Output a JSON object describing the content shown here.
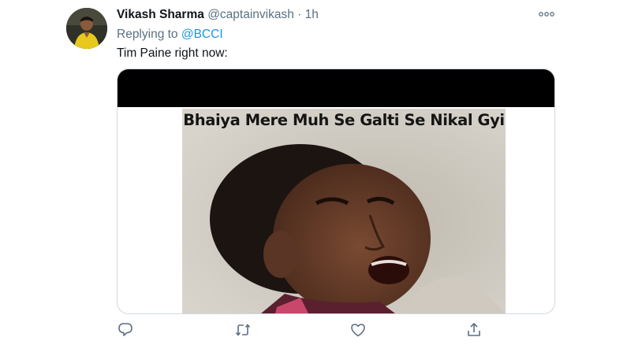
{
  "tweet": {
    "author_name": "Vikash Sharma",
    "author_handle": "@captainvikash",
    "separator": "·",
    "time": "1h",
    "replying_to_label": "Replying to",
    "replying_to_handle": "@BCCI",
    "text": "Tim Paine right now:",
    "media": {
      "caption": "Bhaiya Mere Muh Se Galti Se Nikal Gyi"
    }
  },
  "icons": {
    "more": "more-horizontal-icon",
    "reply": "reply-bubble-icon",
    "retweet": "retweet-icon",
    "like": "heart-icon",
    "share": "share-icon"
  },
  "colors": {
    "text_primary": "#0f1419",
    "text_secondary": "#5b7083",
    "link": "#1b95e0",
    "card_border": "#cfd9de"
  }
}
